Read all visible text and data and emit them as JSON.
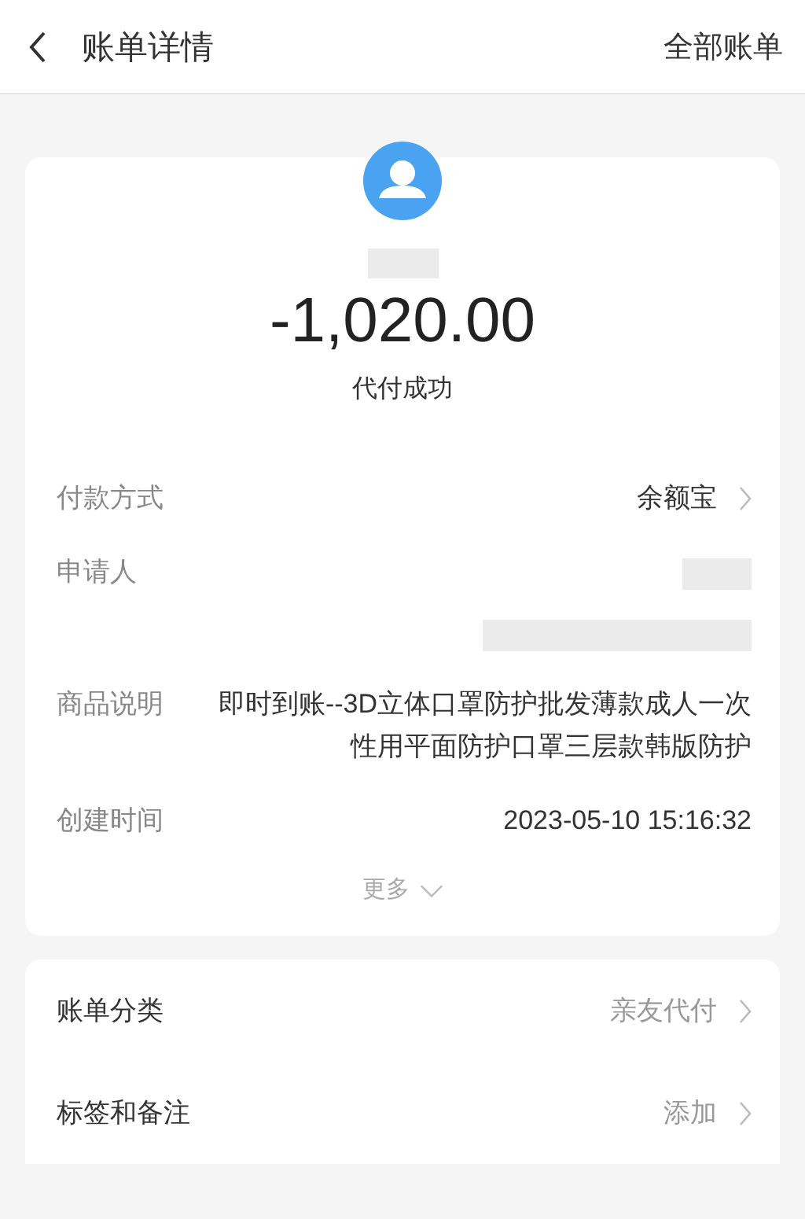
{
  "header": {
    "title": "账单详情",
    "action": "全部账单"
  },
  "summary": {
    "amount": "-1,020.00",
    "status": "代付成功"
  },
  "details": [
    {
      "kind": "link",
      "label": "付款方式",
      "value": "余额宝"
    },
    {
      "kind": "redacted",
      "label": "申请人"
    },
    {
      "kind": "text",
      "label": "商品说明",
      "value": "即时到账--3D立体口罩防护批发薄款成人一次性用平面防护口罩三层款韩版防护"
    },
    {
      "kind": "text",
      "label": "创建时间",
      "value": "2023-05-10 15:16:32"
    }
  ],
  "more": "更多",
  "settings": [
    {
      "label": "账单分类",
      "value": "亲友代付"
    },
    {
      "label": "标签和备注",
      "value": "添加"
    }
  ]
}
